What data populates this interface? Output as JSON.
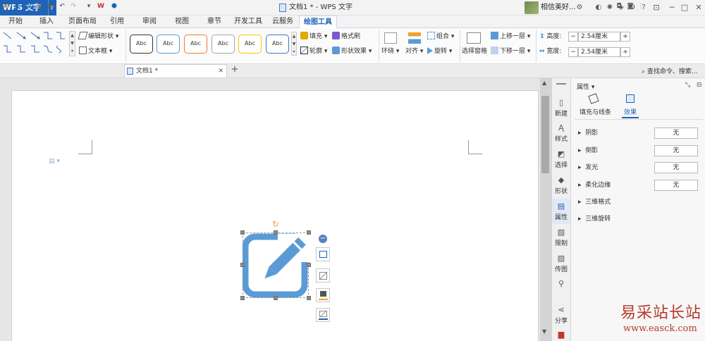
{
  "titlebar": {
    "app_menu": "WPS 文字",
    "doc_title": "文档1 * - WPS 文字",
    "user_name": "相信美好..."
  },
  "tabs": [
    "开始",
    "插入",
    "页面布局",
    "引用",
    "审阅",
    "视图",
    "章节",
    "开发工具",
    "云服务",
    "绘图工具"
  ],
  "ribbon": {
    "edit_shape": "编辑形状",
    "text_box": "文本框",
    "style_samples": [
      "Abc",
      "Abc",
      "Abc",
      "Abc",
      "Abc",
      "Abc"
    ],
    "style_colors": [
      "#333333",
      "#5b9bd5",
      "#ed7d31",
      "#a5a5a5",
      "#ffc000",
      "#4472c4"
    ],
    "fill": "填充",
    "format_painter": "格式刷",
    "outline": "轮廓",
    "shape_effect": "形状效果",
    "wrap": "环绕",
    "align": "对齐",
    "group": "组合",
    "rotate": "旋转",
    "selection_pane": "选择窗格",
    "bring_forward": "上移一层",
    "send_backward": "下移一层",
    "height_label": "高度:",
    "height_value": "2.54厘米",
    "width_label": "宽度:",
    "width_value": "2.54厘米"
  },
  "quickbar": {
    "doc_tab": "文档1 *",
    "search": "查找命令、搜索..."
  },
  "sidebar": {
    "items": [
      "新建",
      "样式",
      "选择",
      "形状",
      "属性",
      "限制",
      "传图",
      "分享"
    ]
  },
  "panel": {
    "title": "属性",
    "tab_fill_line": "填充与线条",
    "tab_effects": "效果",
    "rows": [
      {
        "label": "阴影",
        "value": "无"
      },
      {
        "label": "倒影",
        "value": "无"
      },
      {
        "label": "发光",
        "value": "无"
      },
      {
        "label": "柔化边缘",
        "value": "无"
      },
      {
        "label": "三维格式",
        "value": ""
      },
      {
        "label": "三维旋转",
        "value": ""
      }
    ]
  },
  "watermark": {
    "line1": "易采站长站",
    "line2": "www.easck.com"
  },
  "colors": {
    "brand_blue": "#1e63b7",
    "icon_blue": "#5b9bd5",
    "rotate_handle": "#f0a030"
  }
}
